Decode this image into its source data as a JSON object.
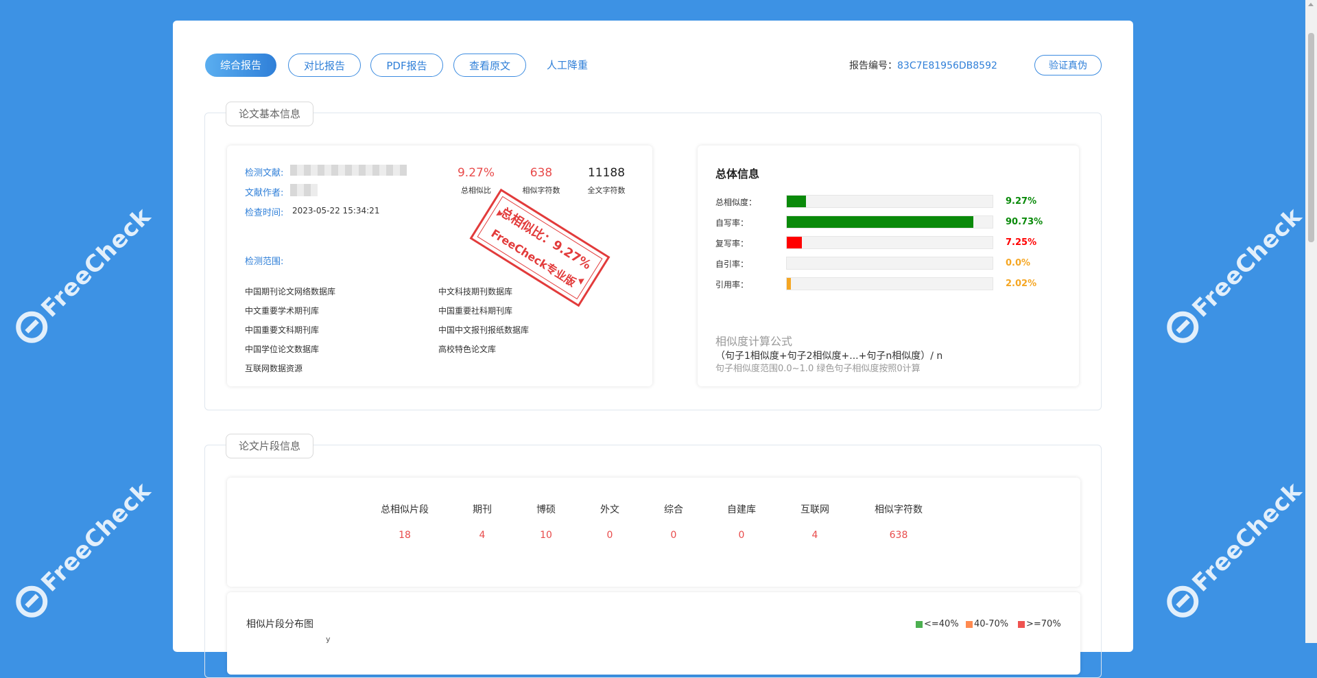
{
  "watermark": {
    "text": "FreeCheck"
  },
  "toolbar": {
    "buttons": [
      {
        "label": "综合报告",
        "active": true
      },
      {
        "label": "对比报告",
        "active": false
      },
      {
        "label": "PDF报告",
        "active": false
      },
      {
        "label": "查看原文",
        "active": false
      }
    ],
    "link_label": "人工降重",
    "report_no_label": "报告编号：",
    "report_no": "83C7E81956DB8592",
    "verify_label": "验证真伪"
  },
  "basic_info": {
    "section_title": "论文基本信息",
    "doc_label": "检测文献:",
    "author_label": "文献作者:",
    "time_label": "检查时间:",
    "time_value": "2023-05-22 15:34:21",
    "stats": [
      {
        "value": "9.27%",
        "caption": "总相似比",
        "color": "#e84b4b"
      },
      {
        "value": "638",
        "caption": "相似字符数",
        "color": "#e84b4b"
      },
      {
        "value": "11188",
        "caption": "全文字符数",
        "color": "#222222"
      }
    ],
    "scope_label": "检测范围:",
    "databases": [
      "中国期刊论文网络数据库",
      "中文科技期刊数据库",
      "中文重要学术期刊库",
      "中国重要社科期刊库",
      "中国重要文科期刊库",
      "中国中文报刊报纸数据库",
      "中国学位论文数据库",
      "高校特色论文库",
      "互联网数据资源"
    ],
    "stamp": {
      "line1": "总相似比：9.27%",
      "line2": "FreeCheck专业版"
    }
  },
  "overview": {
    "title": "总体信息",
    "rows": [
      {
        "label": "总相似度：",
        "value": "9.27%",
        "fraction": 0.0927,
        "color": "#0a8a0a"
      },
      {
        "label": "自写率：",
        "value": "90.73%",
        "fraction": 0.9073,
        "color": "#0a8a0a"
      },
      {
        "label": "复写率：",
        "value": "7.25%",
        "fraction": 0.0725,
        "color": "#ff0000"
      },
      {
        "label": "自引率：",
        "value": "0.0%",
        "fraction": 0.0,
        "color": "#f5a623"
      },
      {
        "label": "引用率：",
        "value": "2.02%",
        "fraction": 0.0202,
        "color": "#f5a623"
      }
    ],
    "formula_title": "相似度计算公式",
    "formula": "（句子1相似度+句子2相似度+...+句子n相似度）/ n",
    "formula_note": "句子相似度范围0.0~1.0 绿色句子相似度按照0计算"
  },
  "segments": {
    "section_title": "论文片段信息",
    "headers": [
      "总相似片段",
      "期刊",
      "博硕",
      "外文",
      "综合",
      "自建库",
      "互联网",
      "相似字符数"
    ],
    "values": [
      "18",
      "4",
      "10",
      "0",
      "0",
      "0",
      "4",
      "638"
    ],
    "dist_title": "相似片段分布图",
    "axis_label": "y",
    "legend": [
      {
        "label": "<=40%",
        "color": "#4caf50"
      },
      {
        "label": "40-70%",
        "color": "#ff8a50"
      },
      {
        "label": ">=70%",
        "color": "#ef5350"
      }
    ]
  }
}
